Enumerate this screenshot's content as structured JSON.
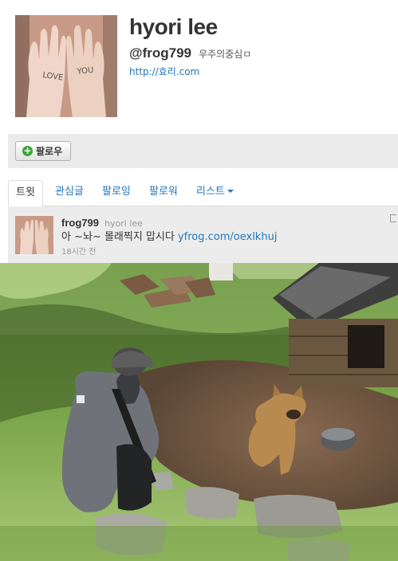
{
  "profile": {
    "name": "hyori lee",
    "handle": "@frog799",
    "bio": "우주의중심ㅁ",
    "url": "http://효리.com"
  },
  "actions": {
    "follow_label": "팔로우"
  },
  "tabs": [
    {
      "label": "트윗",
      "active": true
    },
    {
      "label": "관심글",
      "active": false
    },
    {
      "label": "팔로잉",
      "active": false
    },
    {
      "label": "팔로워",
      "active": false
    },
    {
      "label": "리스트",
      "active": false
    }
  ],
  "tweet": {
    "handle": "frog799",
    "name": "hyori lee",
    "text": "아 ~놔~ 몰래찍지 맙시다 ",
    "link_text": "yfrog.com/oexlkhuj",
    "time": "18시간 전"
  },
  "avatar_text": {
    "left_hand": "LOVE",
    "right_hand": "YOU"
  },
  "colors": {
    "link": "#2276bb",
    "panel": "#ebebeb",
    "follow_icon": "#3ca43c"
  },
  "icons": {
    "follow": "plus-circle-icon",
    "list_dropdown": "caret-down-icon"
  }
}
